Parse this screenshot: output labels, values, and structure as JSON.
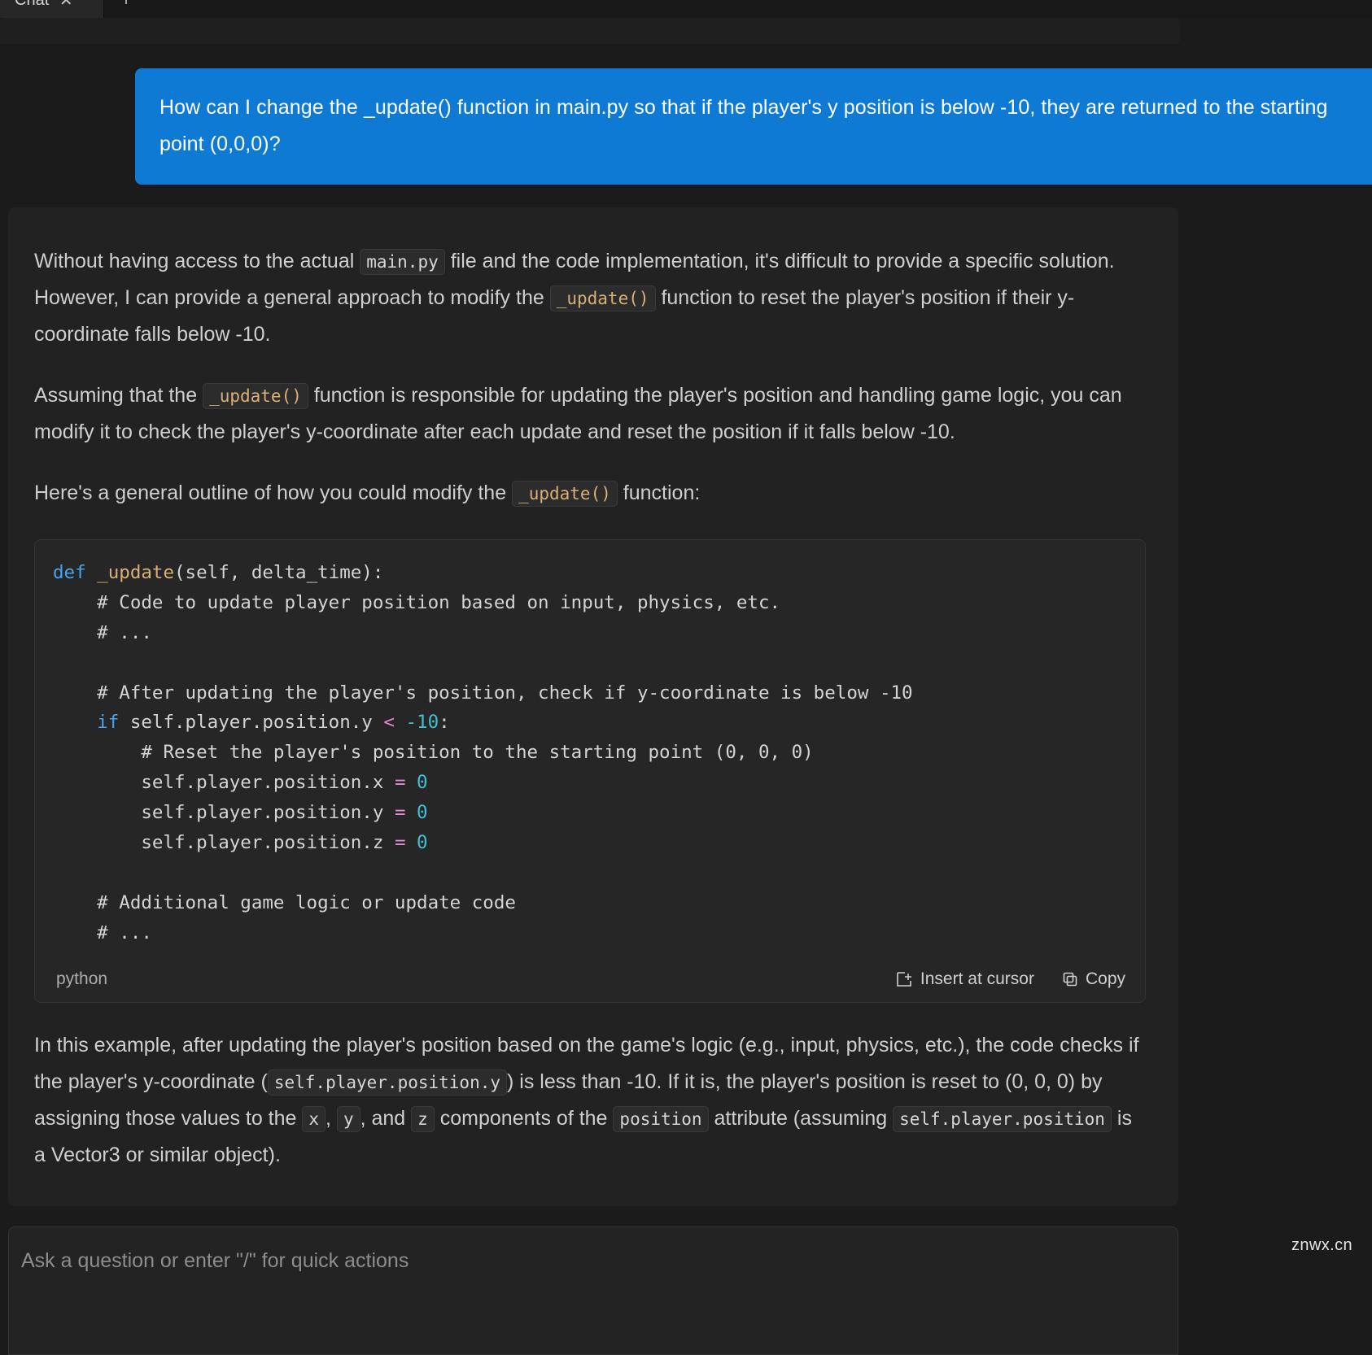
{
  "window": {
    "tab": {
      "label": "Chat",
      "close_icon": "close-icon",
      "new_tab_label": "+"
    }
  },
  "conversation": {
    "user_message": {
      "text": "How can I change the _update() function in main.py so that if the player's y position is below -10, they are returned to the starting point (0,0,0)?",
      "bubble_color": "#0e7ad4"
    },
    "assistant_message": {
      "paragraph_1": {
        "part_1": "Without having access to the actual ",
        "code_1": "main.py",
        "part_2": " file and the code implementation, it's difficult to provide a specific solution. However, I can provide a general approach to modify the ",
        "code_2": "_update()",
        "part_3": " function to reset the player's position if their y-coordinate falls below -10."
      },
      "paragraph_2": {
        "part_1": "Assuming that the ",
        "code_1": "_update()",
        "part_2": " function is responsible for updating the player's position and handling game logic, you can modify it to check the player's y-coordinate after each update and reset the position if it falls below -10."
      },
      "paragraph_3": {
        "part_1": "Here's a general outline of how you could modify the ",
        "code_1": "_update()",
        "part_2": " function:"
      },
      "code_block": {
        "language": "python",
        "lines": [
          {
            "tokens": [
              {
                "t": "def",
                "c": "kw"
              },
              {
                "t": " ",
                "c": ""
              },
              {
                "t": "_update",
                "c": "fn"
              },
              {
                "t": "(self, delta_time):",
                "c": ""
              }
            ]
          },
          {
            "tokens": [
              {
                "t": "    # Code to update player position based on input, physics, etc.",
                "c": "cmt"
              }
            ]
          },
          {
            "tokens": [
              {
                "t": "    # ...",
                "c": "cmt"
              }
            ]
          },
          {
            "tokens": [
              {
                "t": "",
                "c": ""
              }
            ]
          },
          {
            "tokens": [
              {
                "t": "    # After updating the player's position, check if y-coordinate is below -10",
                "c": "cmt"
              }
            ]
          },
          {
            "tokens": [
              {
                "t": "    ",
                "c": ""
              },
              {
                "t": "if",
                "c": "kw"
              },
              {
                "t": " self.player.position.y ",
                "c": ""
              },
              {
                "t": "<",
                "c": "op"
              },
              {
                "t": " ",
                "c": ""
              },
              {
                "t": "-10",
                "c": "num"
              },
              {
                "t": ":",
                "c": ""
              }
            ]
          },
          {
            "tokens": [
              {
                "t": "        # Reset the player's position to the starting point (0, 0, 0)",
                "c": "cmt"
              }
            ]
          },
          {
            "tokens": [
              {
                "t": "        self.player.position.x ",
                "c": ""
              },
              {
                "t": "=",
                "c": "op"
              },
              {
                "t": " ",
                "c": ""
              },
              {
                "t": "0",
                "c": "num"
              }
            ]
          },
          {
            "tokens": [
              {
                "t": "        self.player.position.y ",
                "c": ""
              },
              {
                "t": "=",
                "c": "op"
              },
              {
                "t": " ",
                "c": ""
              },
              {
                "t": "0",
                "c": "num"
              }
            ]
          },
          {
            "tokens": [
              {
                "t": "        self.player.position.z ",
                "c": ""
              },
              {
                "t": "=",
                "c": "op"
              },
              {
                "t": " ",
                "c": ""
              },
              {
                "t": "0",
                "c": "num"
              }
            ]
          },
          {
            "tokens": [
              {
                "t": "",
                "c": ""
              }
            ]
          },
          {
            "tokens": [
              {
                "t": "    # Additional game logic or update code",
                "c": "cmt"
              }
            ]
          },
          {
            "tokens": [
              {
                "t": "    # ...",
                "c": "cmt"
              }
            ]
          }
        ],
        "actions": [
          {
            "label": "Insert at cursor",
            "icon": "insert-at-cursor-icon"
          },
          {
            "label": "Copy",
            "icon": "copy-icon"
          }
        ]
      },
      "paragraph_4": {
        "part_1": "In this example, after updating the player's position based on the game's logic (e.g., input, physics, etc.), the code checks if the player's y-coordinate (",
        "code_1": "self.player.position.y",
        "part_2": ") is less than -10. If it is, the player's position is reset to (0, 0, 0) by assigning those values to the ",
        "code_2": "x",
        "part_3": ", ",
        "code_3": "y",
        "part_4": ", and ",
        "code_4": "z",
        "part_5": " components of the ",
        "code_5": "position",
        "part_6": " attribute (assuming ",
        "code_6": "self.player.position",
        "part_7": " is a Vector3 or similar object)."
      }
    }
  },
  "composer": {
    "placeholder": "Ask a question or enter \"/\" for quick actions"
  },
  "watermark": {
    "text": "znwx.cn"
  }
}
